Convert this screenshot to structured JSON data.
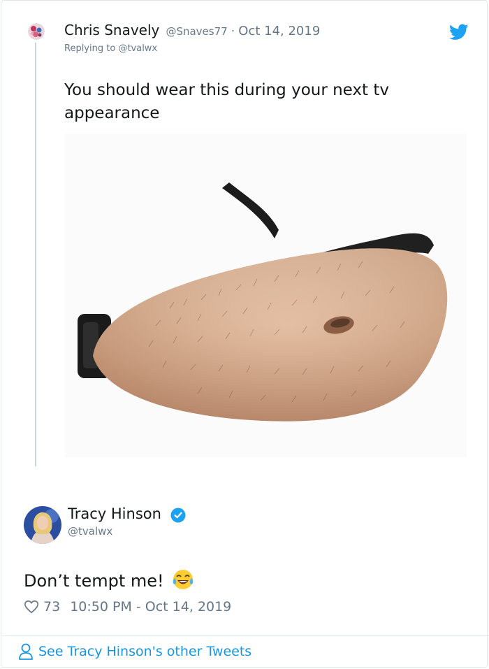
{
  "reply_tweet": {
    "author_name": "Chris Snavely",
    "author_handle": "@Snaves77",
    "separator": "·",
    "date": "Oct 14, 2019",
    "replying_prefix": "Replying to",
    "replying_to": "@tvalwx",
    "text": "You should wear this during your next tv appearance"
  },
  "main_tweet": {
    "author_name": "Tracy Hinson",
    "author_handle": "@tvalwx",
    "text": "Don’t tempt me!",
    "emoji": "😂",
    "likes": "73",
    "timestamp": "10:50 PM - Oct 14, 2019"
  },
  "footer": {
    "link_label": "See Tracy Hinson's other Tweets"
  },
  "icons": {
    "brand": "twitter-bird-icon",
    "verified": "verified-badge-icon",
    "like": "heart-icon",
    "profile": "person-icon"
  },
  "colors": {
    "brand_blue": "#1da1f2",
    "link_blue": "#1b95e0",
    "muted_gray": "#657786",
    "text": "#14171a",
    "thread_line": "#ccd6dd"
  }
}
